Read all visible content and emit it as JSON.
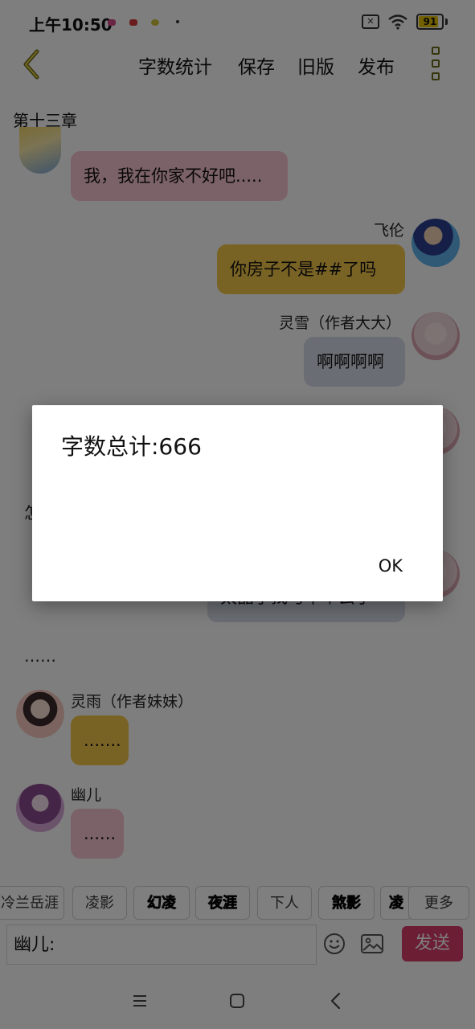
{
  "status_bar": {
    "time": "上午10:50",
    "battery": "91",
    "battery_level": 0.91
  },
  "toolbar": {
    "word_count": "字数统计",
    "save": "保存",
    "old_version": "旧版",
    "publish": "发布"
  },
  "chapter_title": "第十三章",
  "messages": [
    {
      "text": "我，我在你家不好吧....."
    },
    {
      "name": "飞伦",
      "text": "你房子不是##了吗"
    },
    {
      "name": "灵雪（作者大大）",
      "text": "啊啊啊啊"
    },
    {
      "text": "……"
    },
    {
      "name": "灵雨（作者妹妹）",
      "text": "......."
    },
    {
      "name": "幽儿",
      "text": "......"
    }
  ],
  "hidden_fragments": {
    "left_char": "怎",
    "bubble_fragment": "太晶了找与十个云了"
  },
  "chips": [
    "冷兰岳涯",
    "凌影",
    "幻凌",
    "夜涯",
    "下人",
    "煞影",
    "凌"
  ],
  "more_label": "更多",
  "input": {
    "value": "幽儿:"
  },
  "send_label": "发送",
  "dialog": {
    "title": "字数总计:666",
    "ok_label": "OK"
  },
  "colors": {
    "pink_bubble": "#f6c5d0",
    "gold_bubble": "#f2c649",
    "gray_bubble": "#d5dbe6",
    "send": "#d93c6a",
    "back_arrow": "#6b6b18"
  }
}
